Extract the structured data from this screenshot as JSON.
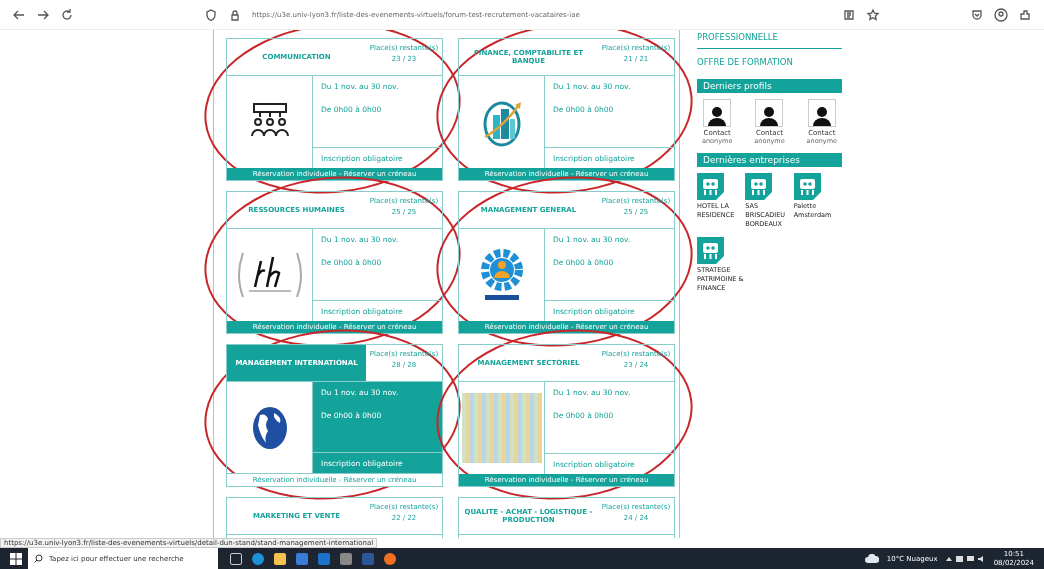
{
  "browser": {
    "url": "https://u3e.univ-lyon3.fr/liste-des-evenements-virtuels/forum-test-recrutement-vacataires-iae"
  },
  "stands": [
    {
      "kind": "communication",
      "title": "COMMUNICATION",
      "places_label": "Place(s) restante(s)",
      "places": "23 / 23",
      "dates": "Du 1 nov. au 30 nov.",
      "hours": "De 0h00 à 0h00",
      "note": "Inscription obligatoire",
      "reserve": "Réservation individuelle - Réserver un créneau",
      "highlighted": false,
      "circled": true
    },
    {
      "kind": "finance",
      "title": "FINANCE, COMPTABILITE ET BANQUE",
      "places_label": "Place(s) restante(s)",
      "places": "21 / 21",
      "dates": "Du 1 nov. au 30 nov.",
      "hours": "De 0h00 à 0h00",
      "note": "Inscription obligatoire",
      "reserve": "Réservation individuelle - Réserver un créneau",
      "highlighted": false,
      "circled": true
    },
    {
      "kind": "rh",
      "title": "RESSOURCES HUMAINES",
      "places_label": "Place(s) restante(s)",
      "places": "25 / 25",
      "dates": "Du 1 nov. au 30 nov.",
      "hours": "De 0h00 à 0h00",
      "note": "Inscription obligatoire",
      "reserve": "Réservation individuelle - Réserver un créneau",
      "highlighted": false,
      "circled": true
    },
    {
      "kind": "gear",
      "title": "MANAGEMENT GENERAL",
      "places_label": "Place(s) restante(s)",
      "places": "25 / 25",
      "dates": "Du 1 nov. au 30 nov.",
      "hours": "De 0h00 à 0h00",
      "note": "Inscription obligatoire",
      "reserve": "Réservation individuelle - Réserver un créneau",
      "highlighted": false,
      "circled": true
    },
    {
      "kind": "globe",
      "title": "MANAGEMENT INTERNATIONAL",
      "places_label": "Place(s) restante(s)",
      "places": "28 / 28",
      "dates": "Du 1 nov. au 30 nov.",
      "hours": "De 0h00 à 0h00",
      "note": "Inscription obligatoire",
      "reserve": "Réservation individuelle - Réserver un créneau",
      "highlighted": true,
      "circled": true
    },
    {
      "kind": "cloud",
      "title": "MANAGEMENT SECTORIEL",
      "places_label": "Place(s) restante(s)",
      "places": "23 / 24",
      "dates": "Du 1 nov. au 30 nov.",
      "hours": "De 0h00 à 0h00",
      "note": "Inscription obligatoire",
      "reserve": "Réservation individuelle - Réserver un créneau",
      "highlighted": false,
      "circled": true
    },
    {
      "kind": "none",
      "title": "MARKETING ET VENTE",
      "places_label": "Place(s) restante(s)",
      "places": "22 / 22",
      "highlighted": false,
      "circled": false
    },
    {
      "kind": "none",
      "title": "QUALITE - ACHAT - LOGISTIQUE - PRODUCTION",
      "places_label": "Place(s) restante(s)",
      "places": "24 / 24",
      "highlighted": false,
      "circled": false
    }
  ],
  "sidebar": {
    "links": [
      "PROFESSIONNELLE",
      "OFFRE DE FORMATION"
    ],
    "profiles_title": "Derniers profils",
    "profiles": [
      {
        "line1": "Contact",
        "line2": "anonyme"
      },
      {
        "line1": "Contact",
        "line2": "anonyme"
      },
      {
        "line1": "Contact",
        "line2": "anonyme"
      }
    ],
    "companies_title": "Dernières entreprises",
    "companies": [
      "HOTEL LA RESIDENCE",
      "SAS BRISCADIEU BORDEAUX",
      "Palette Amsterdam",
      "STRATEGE PATRIMOINE & FINANCE"
    ]
  },
  "status_url": "https://u3e.univ-lyon3.fr/liste-des-evenements-virtuels/detail-dun-stand/stand-management-international",
  "taskbar": {
    "search_placeholder": "Tapez ici pour effectuer une recherche",
    "weather": "10°C Nuageux",
    "time": "10:51",
    "date": "08/02/2024"
  }
}
